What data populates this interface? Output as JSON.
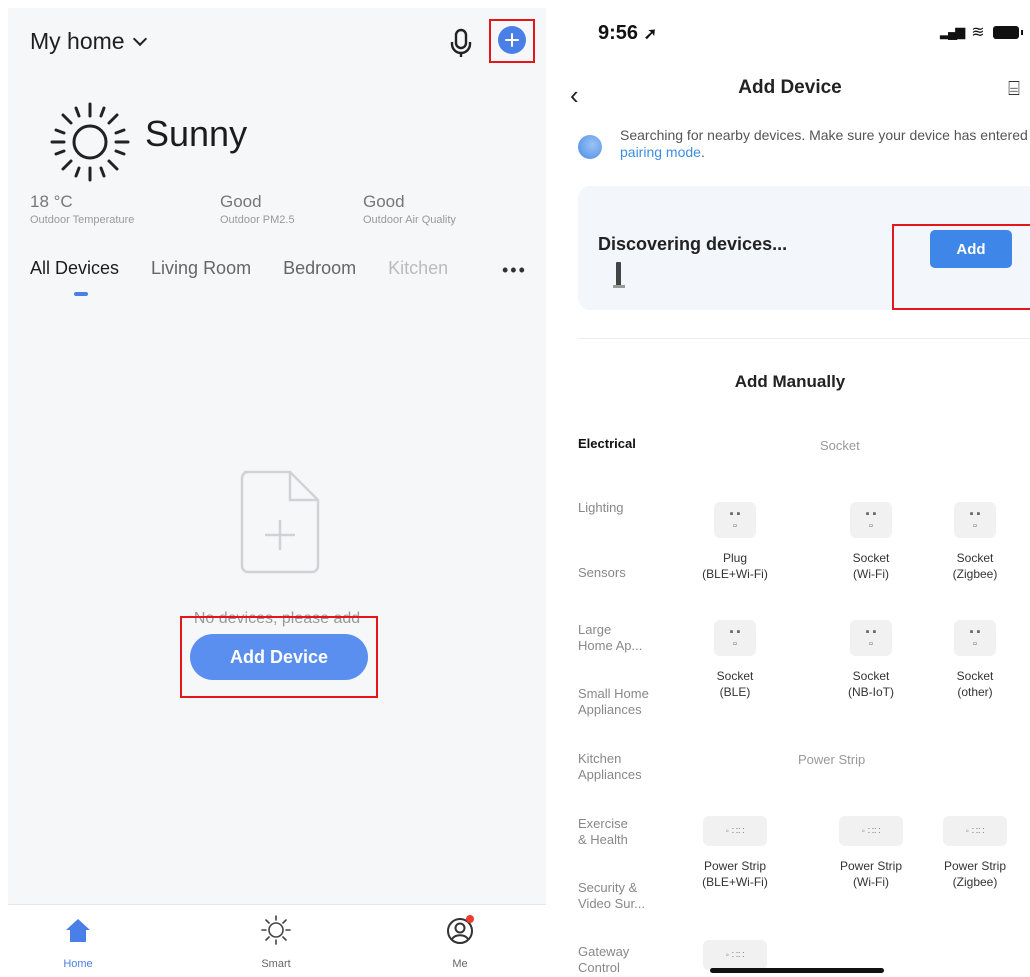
{
  "left": {
    "home_title": "My home",
    "weather": {
      "condition": "Sunny"
    },
    "stats": [
      {
        "value": "18 °C",
        "label": "Outdoor Temperature"
      },
      {
        "value": "Good",
        "label": "Outdoor PM2.5"
      },
      {
        "value": "Good",
        "label": "Outdoor Air Quality"
      }
    ],
    "tabs": [
      "All Devices",
      "Living Room",
      "Bedroom",
      "Kitchen"
    ],
    "empty_message": "No devices, please add",
    "add_device_label": "Add Device",
    "bottom_nav": [
      {
        "label": "Home",
        "icon": "home-icon"
      },
      {
        "label": "Smart",
        "icon": "sun-icon"
      },
      {
        "label": "Me",
        "icon": "profile-icon"
      }
    ],
    "accent": "#4a7fe8"
  },
  "right": {
    "status": {
      "time": "9:56"
    },
    "title": "Add Device",
    "search": {
      "text": "Searching for nearby devices. Make sure your device has entered",
      "link": "pairing mode",
      "end": "."
    },
    "discover": {
      "title": "Discovering devices...",
      "add_label": "Add"
    },
    "manual_title": "Add Manually",
    "categories": [
      "Electrical",
      "Lighting",
      "Sensors",
      "Large\nHome Ap...",
      "Small Home\nAppliances",
      "Kitchen\nAppliances",
      "Exercise\n& Health",
      "Security &\nVideo Sur...",
      "Gateway\nControl"
    ],
    "socket_heading": "Socket",
    "power_strip_heading": "Power Strip",
    "sockets": [
      {
        "line1": "Plug",
        "line2": "(BLE+Wi-Fi)"
      },
      {
        "line1": "Socket",
        "line2": "(Wi-Fi)"
      },
      {
        "line1": "Socket",
        "line2": "(Zigbee)"
      },
      {
        "line1": "Socket",
        "line2": "(BLE)"
      },
      {
        "line1": "Socket",
        "line2": "(NB-IoT)"
      },
      {
        "line1": "Socket",
        "line2": "(other)"
      }
    ],
    "strips": [
      {
        "line1": "Power Strip",
        "line2": "(BLE+Wi-Fi)"
      },
      {
        "line1": "Power Strip",
        "line2": "(Wi-Fi)"
      },
      {
        "line1": "Power Strip",
        "line2": "(Zigbee)"
      }
    ],
    "highlight_color": "#e3161b"
  }
}
